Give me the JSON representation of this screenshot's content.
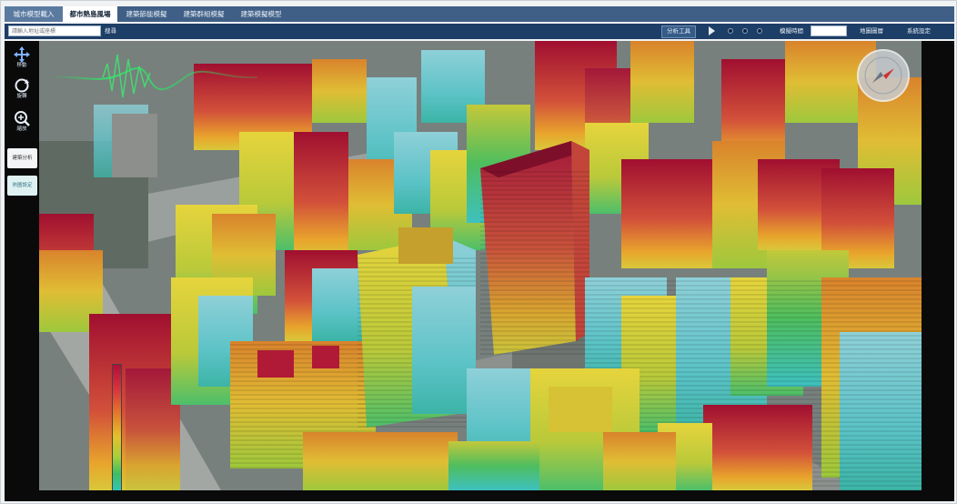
{
  "tabs": [
    {
      "label": "城市模型載入"
    },
    {
      "label": "都市熱島風場"
    },
    {
      "label": "建築節能模擬"
    },
    {
      "label": "建築群組模擬"
    },
    {
      "label": "建築模擬模型"
    }
  ],
  "toolbar": {
    "search_placeholder": "請輸入地址或座標",
    "search_label": "搜尋",
    "analysis_button": "分析工具",
    "time_label": "模擬時間",
    "layers_button": "地圖圖層",
    "settings_button": "系統設定"
  },
  "side_tools": [
    {
      "label": "移動",
      "icon": "move-icon"
    },
    {
      "label": "旋轉",
      "icon": "rotate-icon"
    },
    {
      "label": "縮放",
      "icon": "zoom-icon"
    }
  ],
  "side_buttons": [
    {
      "label": "建築分析"
    },
    {
      "label": "熱圖設定"
    }
  ],
  "legend": {
    "colors": [
      "#b20d3a",
      "#e7782a",
      "#e4c128",
      "#3dbf62",
      "#75dce7"
    ]
  },
  "compass": {
    "icon": "compass-icon"
  }
}
